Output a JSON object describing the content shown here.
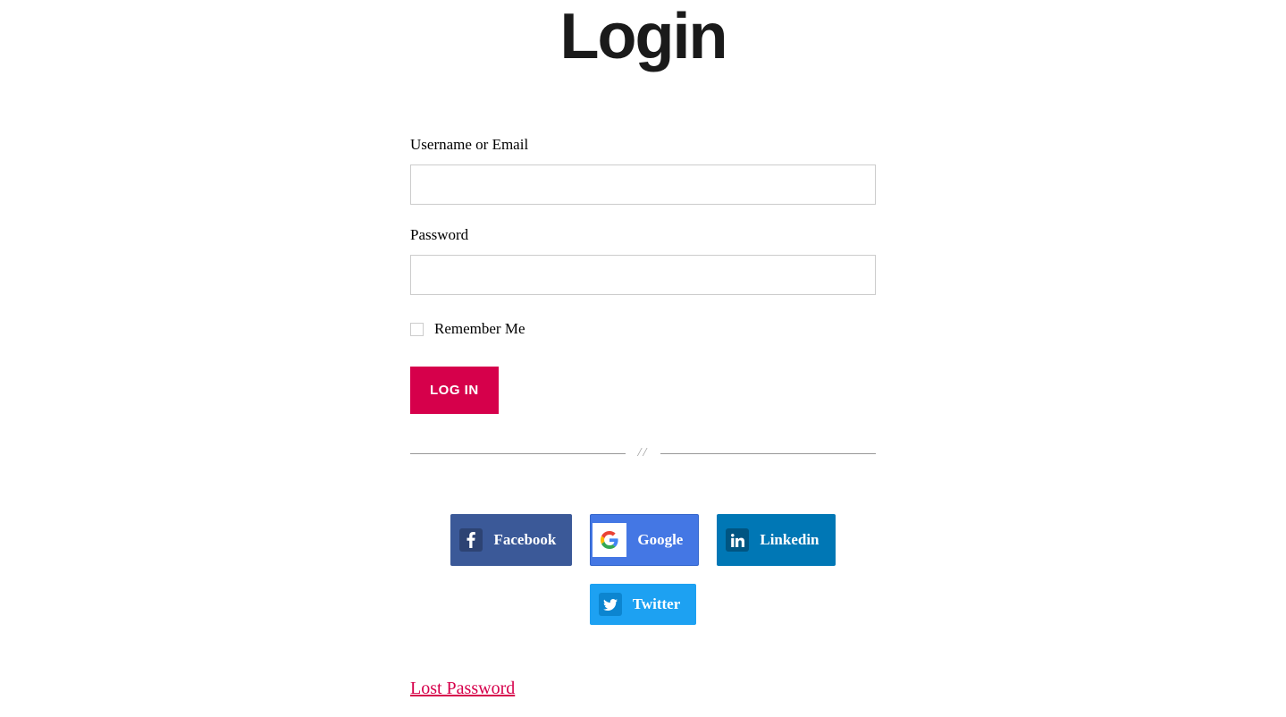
{
  "page": {
    "title": "Login"
  },
  "form": {
    "username_label": "Username or Email",
    "password_label": "Password",
    "remember_label": "Remember Me",
    "submit_label": "LOG IN"
  },
  "divider": {
    "text": "//"
  },
  "social": {
    "facebook_label": "Facebook",
    "google_label": "Google",
    "linkedin_label": "Linkedin",
    "twitter_label": "Twitter"
  },
  "links": {
    "lost_password": "Lost Password"
  },
  "colors": {
    "accent": "#d6004b",
    "facebook": "#3b5998",
    "google": "#4477e4",
    "linkedin": "#0077b5",
    "twitter": "#1da1f2"
  }
}
